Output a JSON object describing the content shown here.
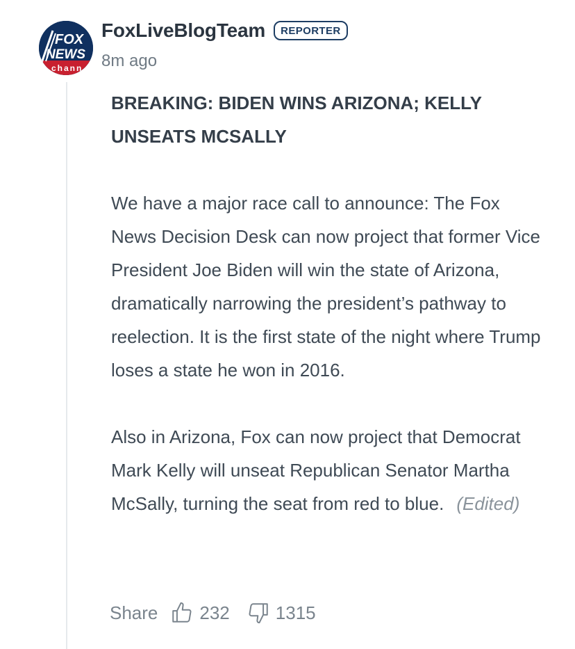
{
  "post": {
    "author": "FoxLiveBlogTeam",
    "badge": "REPORTER",
    "time": "8m ago",
    "avatar": {
      "line1": "FOX",
      "line2": "NEWS",
      "line3": "chann",
      "colors": {
        "navy": "#10305f",
        "red": "#c8202f",
        "white": "#ffffff"
      }
    },
    "headline": "BREAKING: BIDEN WINS ARIZONA; KELLY UNSEATS MCSALLY",
    "paragraphs": [
      "We have a major race call to announce: The Fox News Decision Desk can now project that former Vice President Joe Biden will win the state of Arizona, dramatically narrowing the president’s pathway to reelection. It is the first state of the night where Trump loses a state he won in 2016.",
      "Also in Arizona, Fox can now project that Democrat Mark Kelly will unseat Republican Senator Martha McSally, turning the seat from red to blue."
    ],
    "edited_label": "(Edited)"
  },
  "actions": {
    "share_label": "Share",
    "upvote_icon": "thumbs-up-icon",
    "upvotes": "232",
    "downvote_icon": "thumbs-down-icon",
    "downvotes": "1315"
  }
}
